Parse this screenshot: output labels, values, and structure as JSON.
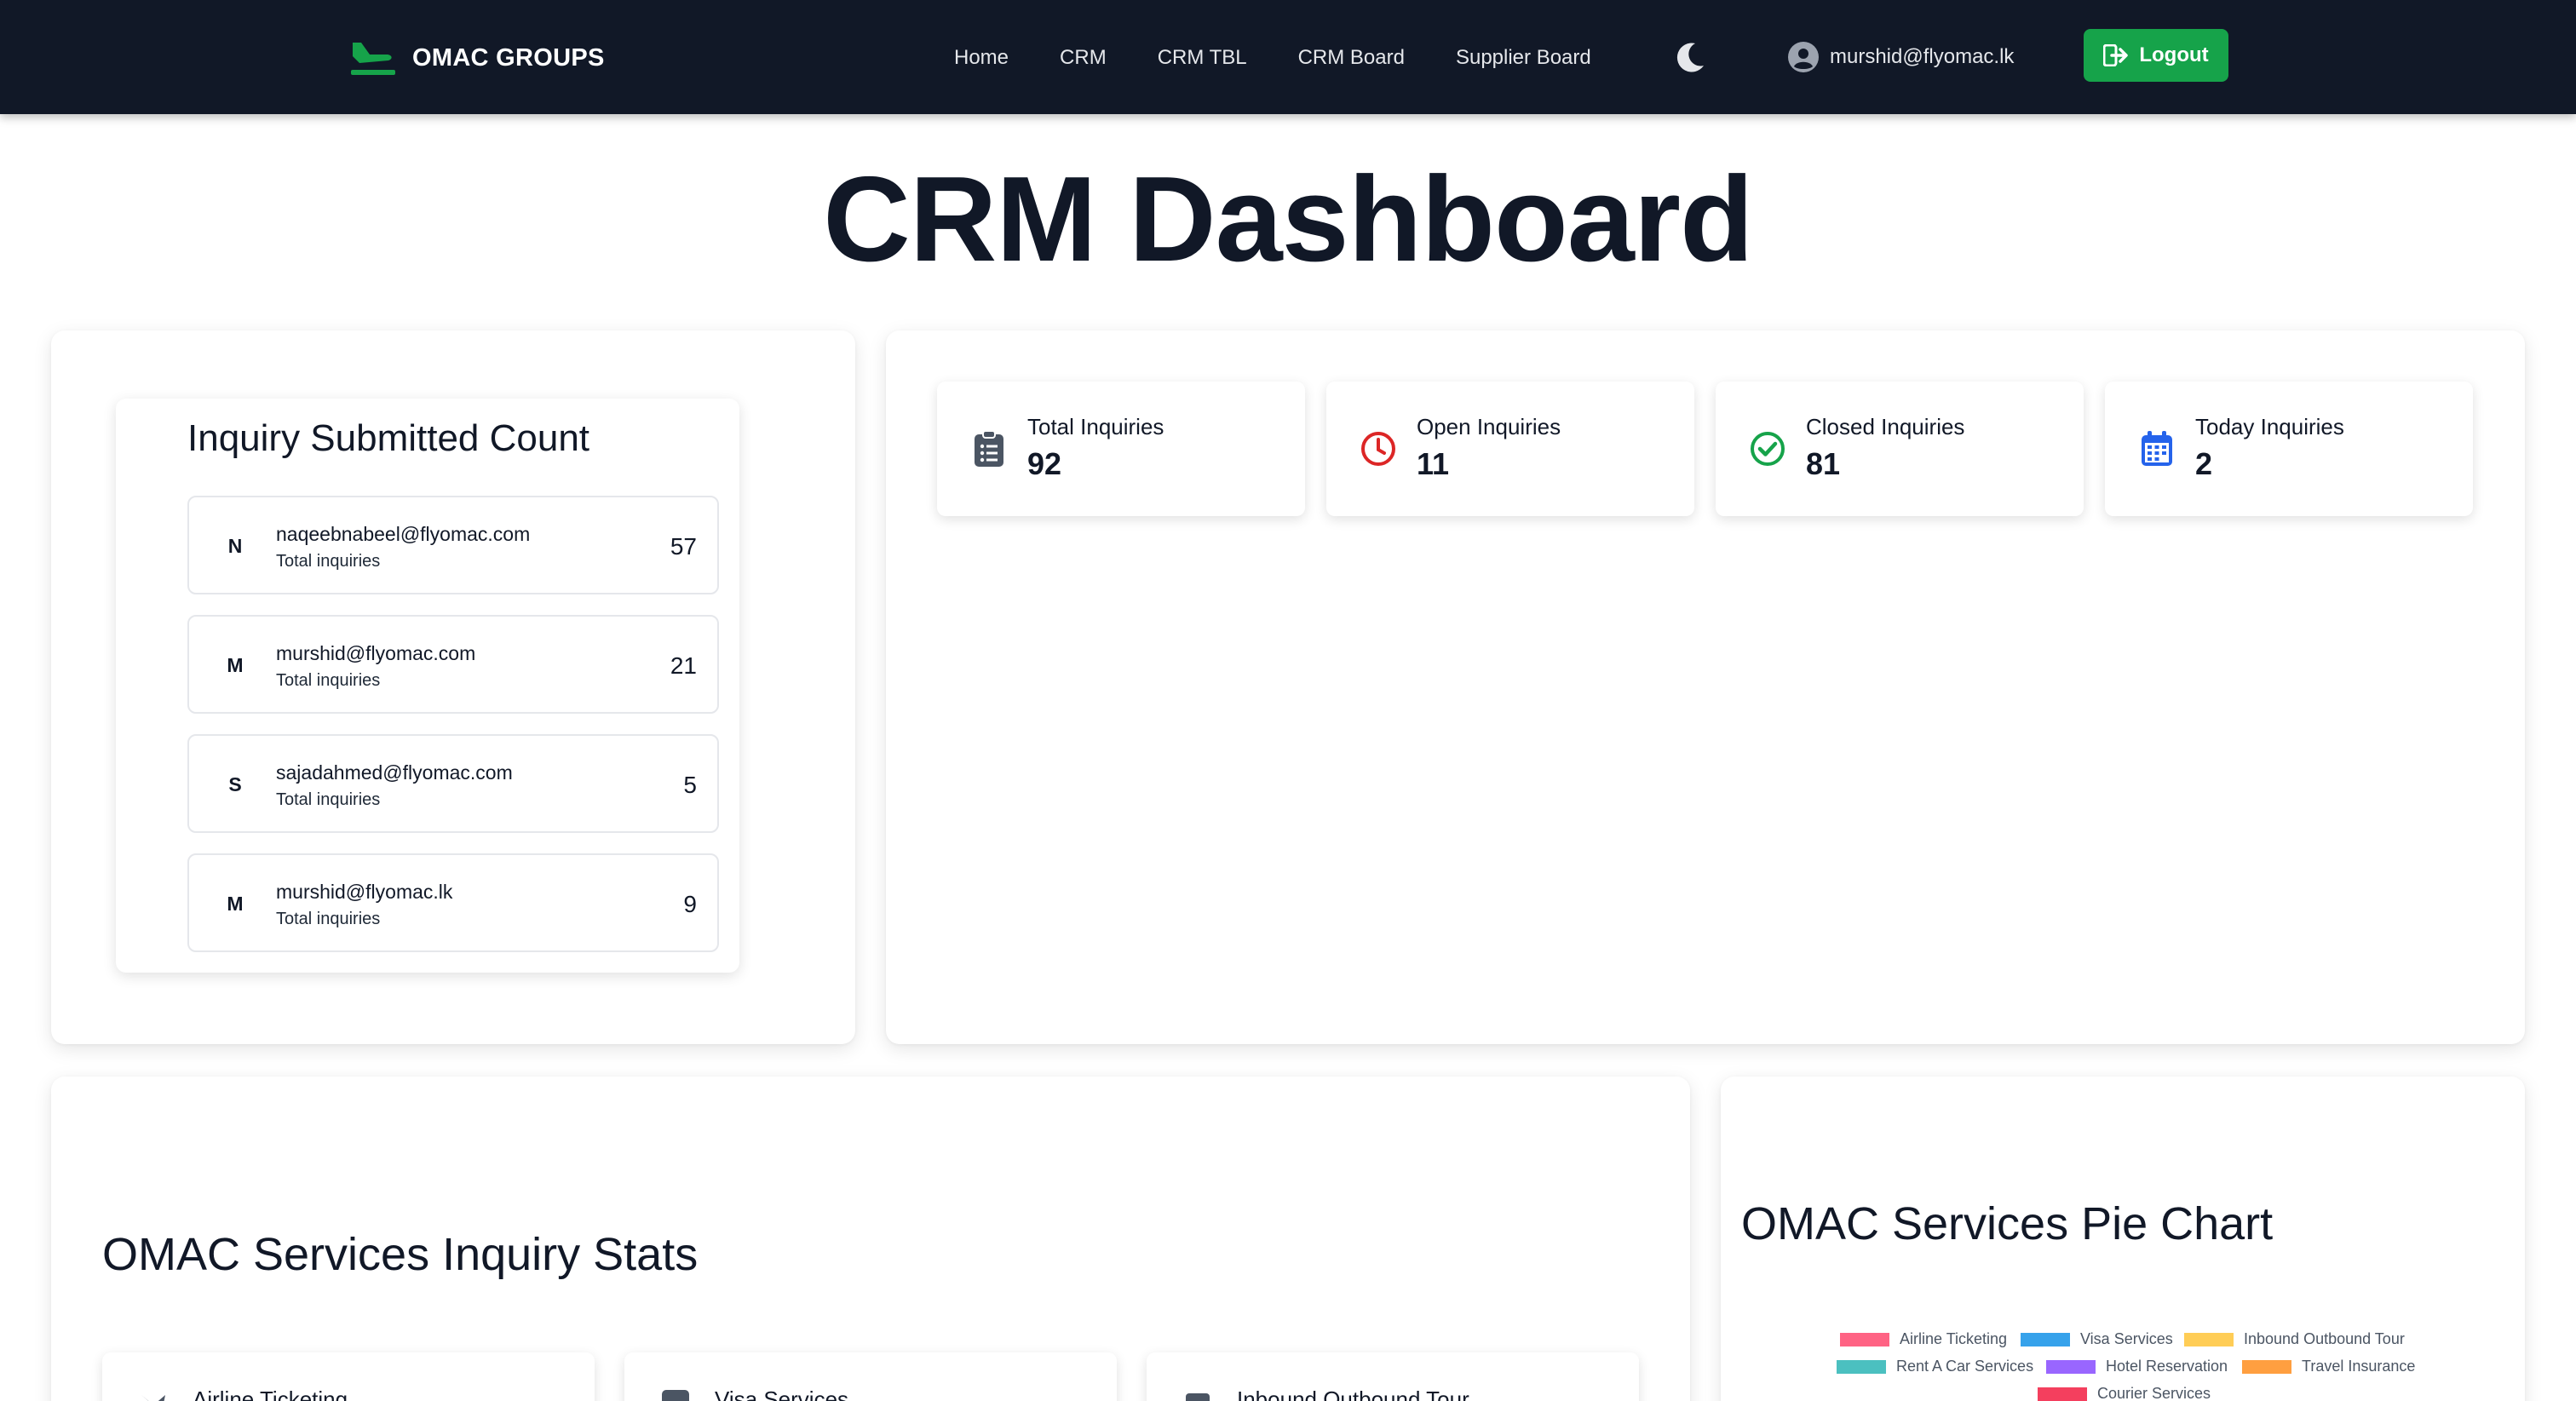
{
  "brand": {
    "name": "OMAC GROUPS",
    "color": "#16a34a"
  },
  "nav": {
    "links": [
      "Home",
      "CRM",
      "CRM TBL",
      "CRM Board",
      "Supplier Board"
    ],
    "user_email": "murshid@flyomac.lk",
    "logout_label": "Logout"
  },
  "page": {
    "title": "CRM Dashboard"
  },
  "inquiry_count": {
    "title": "Inquiry Submitted Count",
    "rows": [
      {
        "initial": "N",
        "email": "naqeebnabeel@flyomac.com",
        "sub": "Total inquiries",
        "count": "57"
      },
      {
        "initial": "M",
        "email": "murshid@flyomac.com",
        "sub": "Total inquiries",
        "count": "21"
      },
      {
        "initial": "S",
        "email": "sajadahmed@flyomac.com",
        "sub": "Total inquiries",
        "count": "5"
      },
      {
        "initial": "M",
        "email": "murshid@flyomac.lk",
        "sub": "Total inquiries",
        "count": "9"
      }
    ]
  },
  "stats": [
    {
      "label": "Total Inquiries",
      "value": "92",
      "icon": "clipboard-list-icon",
      "color": "#4b5563"
    },
    {
      "label": "Open Inquiries",
      "value": "11",
      "icon": "clock-icon",
      "color": "#dc2626"
    },
    {
      "label": "Closed Inquiries",
      "value": "81",
      "icon": "check-circle-icon",
      "color": "#16a34a"
    },
    {
      "label": "Today Inquiries",
      "value": "2",
      "icon": "calendar-icon",
      "color": "#2563eb"
    }
  ],
  "services_section": {
    "title": "OMAC Services Inquiry Stats",
    "cards": [
      "Airline Ticketing",
      "Visa Services",
      "Inbound Outbound Tour"
    ]
  },
  "pie_section": {
    "title": "OMAC Services Pie Chart",
    "legend": [
      {
        "label": "Airline Ticketing",
        "color": "#ff6384"
      },
      {
        "label": "Visa Services",
        "color": "#36a2eb"
      },
      {
        "label": "Inbound Outbound Tour",
        "color": "#ffcd56"
      },
      {
        "label": "Rent A Car Services",
        "color": "#4bc0c0"
      },
      {
        "label": "Hotel Reservation",
        "color": "#9966ff"
      },
      {
        "label": "Travel Insurance",
        "color": "#ff9f40"
      },
      {
        "label": "Courier Services",
        "color": "#f43f5e"
      }
    ]
  }
}
